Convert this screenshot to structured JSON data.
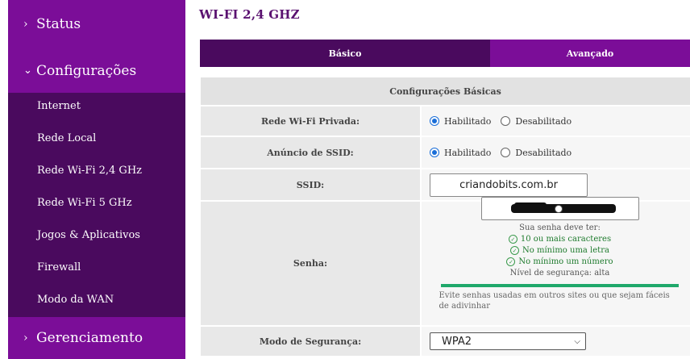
{
  "sidebar": {
    "status_label": "Status",
    "config_label": "Configurações",
    "items": [
      {
        "label": "Internet"
      },
      {
        "label": "Rede Local"
      },
      {
        "label": "Rede Wi-Fi 2,4 GHz"
      },
      {
        "label": "Rede Wi-Fi 5 GHz"
      },
      {
        "label": "Jogos & Aplicativos"
      },
      {
        "label": "Firewall"
      },
      {
        "label": "Modo da WAN"
      }
    ],
    "gerenciamento_label": "Gerenciamento",
    "chevron_collapsed": "›",
    "chevron_expanded": "⌄"
  },
  "page": {
    "title": "WI-FI 2,4 GHZ"
  },
  "tabs": {
    "basico": "Básico",
    "avancado": "Avançado"
  },
  "form": {
    "section_title": "Configurações Básicas",
    "rede_privada": {
      "label": "Rede Wi-Fi Privada:",
      "option_on": "Habilitado",
      "option_off": "Desabilitado",
      "selected": "Habilitado"
    },
    "anuncio_ssid": {
      "label": "Anúncio de SSID:",
      "option_on": "Habilitado",
      "option_off": "Desabilitado",
      "selected": "Habilitado"
    },
    "ssid": {
      "label": "SSID:",
      "value": "criandobits.com.br"
    },
    "senha": {
      "label": "Senha:",
      "requirements_title": "Sua senha deve ter:",
      "requirements": [
        "10 ou mais caracteres",
        "No mínimo uma letra",
        "No mínimo um número"
      ],
      "level_text": "Nível de segurança: alta",
      "hint": "Evite senhas usadas em outros sites ou que sejam fáceis de adivinhar"
    },
    "modo_seguranca": {
      "label": "Modo de Segurança:",
      "value": "WPA2"
    }
  },
  "colors": {
    "brand_purple": "#7b0d98",
    "dark_purple": "#4a0a5e",
    "strength_green": "#1fa86a",
    "radio_blue": "#1a6ed8"
  },
  "icons": {
    "check": "✓"
  }
}
